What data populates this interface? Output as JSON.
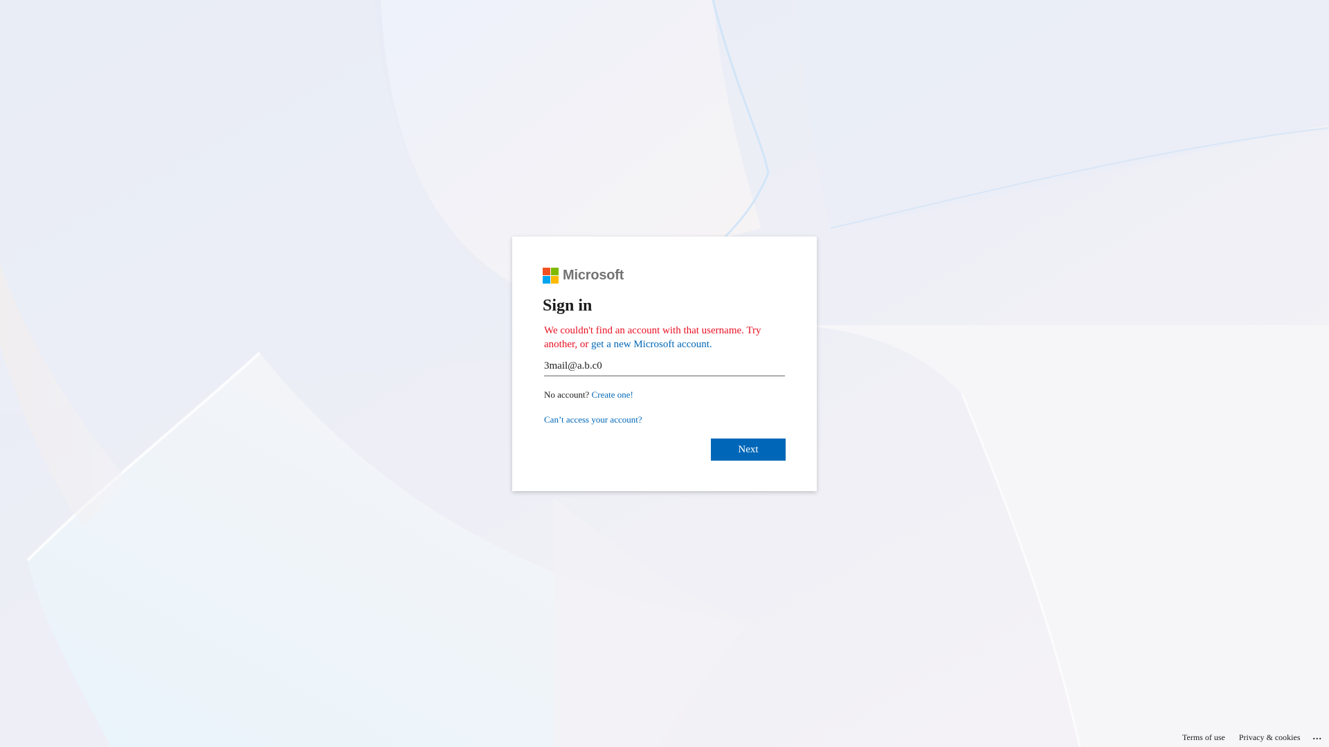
{
  "brand": {
    "name": "Microsoft",
    "logo_colors": [
      "#f25022",
      "#7fba00",
      "#00a4ef",
      "#ffb900"
    ]
  },
  "signin": {
    "title": "Sign in",
    "error_text": "We couldn't find an account with that username. Try another, or ",
    "error_link": "get a new Microsoft account.",
    "email_value": "3mail@a.b.c0",
    "no_account_text": "No account?",
    "create_link": "Create one!",
    "cant_access_link": "Can’t access your account?",
    "next_label": "Next"
  },
  "footer": {
    "terms": "Terms of use",
    "privacy": "Privacy & cookies",
    "more": "..."
  },
  "colors": {
    "accent": "#0067b8",
    "error": "#e81123",
    "text": "#1b1b1b"
  }
}
